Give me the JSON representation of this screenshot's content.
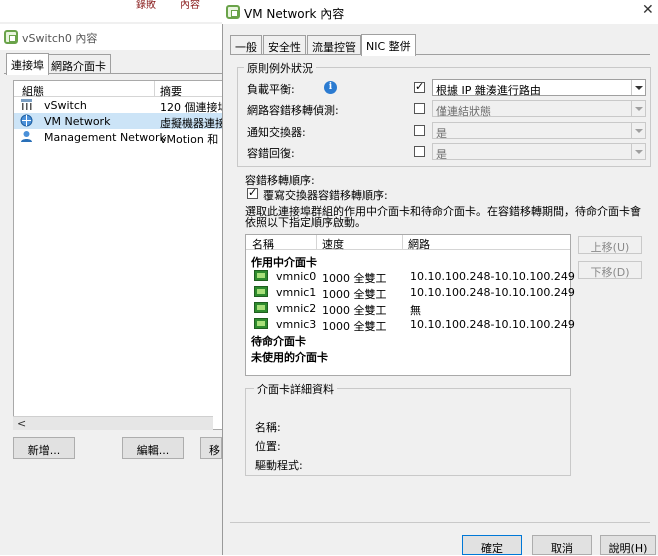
{
  "bg_window": {
    "top_strip": [
      "錄敗",
      "內容"
    ],
    "title": "vSwitch0 內容",
    "tabs": [
      "連接埠",
      "網路介面卡"
    ],
    "columns": [
      "組態",
      "摘要"
    ],
    "rows": [
      {
        "name": "vSwitch",
        "summary": "120 個連接埠",
        "icon": "switch-icon",
        "selected": false
      },
      {
        "name": "VM Network",
        "summary": "虛擬機器連接",
        "icon": "vm-network-icon",
        "selected": true
      },
      {
        "name": "Management Network",
        "summary": "vMotion 和 IP",
        "icon": "management-network-icon",
        "selected": false
      }
    ],
    "scroll_left": "<",
    "buttons": {
      "add": "新增...",
      "edit": "編輯...",
      "remove": "移"
    }
  },
  "dialog": {
    "title": "VM Network 內容",
    "close_glyph": "✕",
    "tabs": [
      "一般",
      "安全性",
      "流量控管",
      "NIC 整併"
    ],
    "active_tab": 3,
    "policy_group": {
      "label": "原則例外狀況",
      "rows": [
        {
          "label": "負載平衡:",
          "checked": true,
          "value": "根據 IP 雜湊進行路由",
          "enabled": true
        },
        {
          "label": "網路容錯移轉偵測:",
          "checked": false,
          "value": "僅連結狀態",
          "enabled": false
        },
        {
          "label": "通知交換器:",
          "checked": false,
          "value": "是",
          "enabled": false
        },
        {
          "label": "容錯回復:",
          "checked": false,
          "value": "是",
          "enabled": false
        }
      ]
    },
    "failover": {
      "heading": "容錯移轉順序:",
      "override_label": "覆寫交換器容錯移轉順序:",
      "override_checked": true,
      "description_line1": "選取此連接埠群組的作用中介面卡和待命介面卡。在容錯移轉期間，待命介面卡會",
      "description_line2": "依照以下指定順序啟動。"
    },
    "nic_table": {
      "columns": [
        "名稱",
        "速度",
        "網路"
      ],
      "sections": {
        "active": "作用中介面卡",
        "standby": "待命介面卡",
        "unused": "未使用的介面卡"
      },
      "active_nics": [
        {
          "name": "vmnic0",
          "speed": "1000 全雙工",
          "network": "10.10.100.248-10.10.100.249"
        },
        {
          "name": "vmnic1",
          "speed": "1000 全雙工",
          "network": "10.10.100.248-10.10.100.249"
        },
        {
          "name": "vmnic2",
          "speed": "1000 全雙工",
          "network": "無"
        },
        {
          "name": "vmnic3",
          "speed": "1000 全雙工",
          "network": "10.10.100.248-10.10.100.249"
        }
      ]
    },
    "move_up": "上移(U)",
    "move_down": "下移(D)",
    "details": {
      "label": "介面卡詳細資料",
      "name_label": "名稱:",
      "location_label": "位置:",
      "driver_label": "驅動程式:"
    },
    "footer": {
      "ok": "確定",
      "cancel": "取消",
      "help": "說明(H)"
    }
  }
}
